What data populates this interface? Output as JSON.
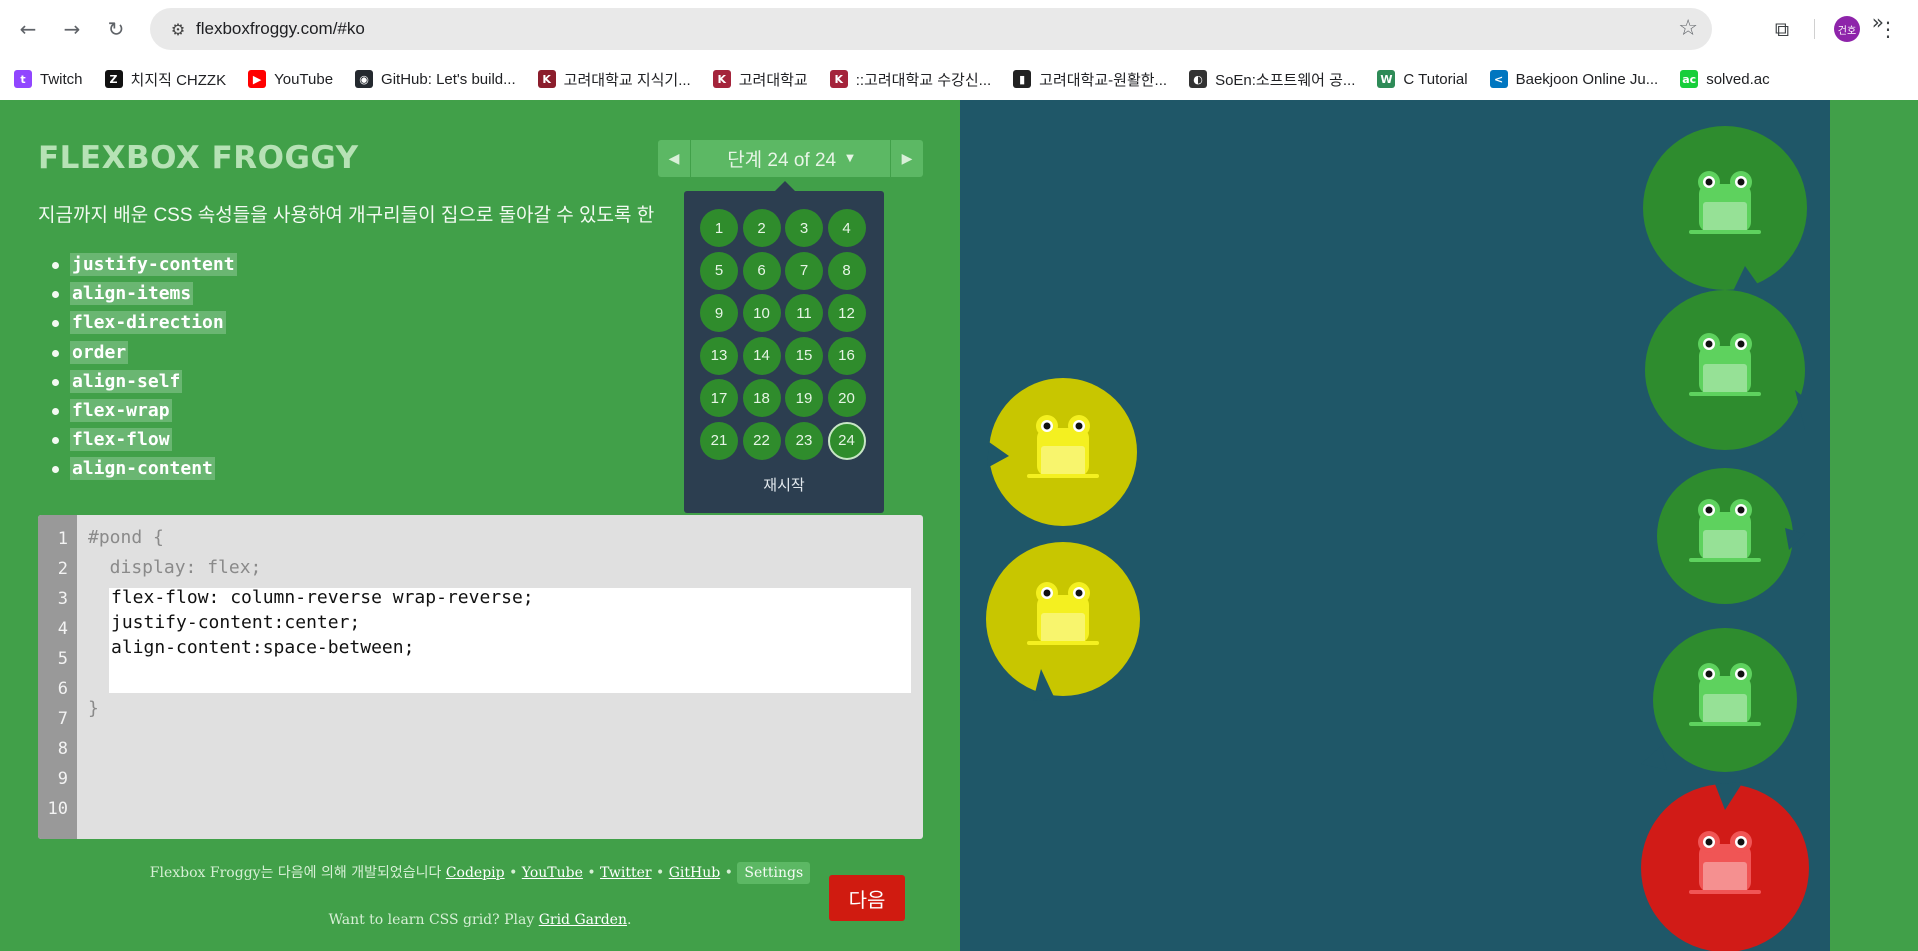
{
  "browser": {
    "url": "flexboxfroggy.com/#ko",
    "back_icon": "arrow-left-icon",
    "avatar_label": "건호",
    "bookmarks": [
      {
        "label": "Twitch",
        "color": "#9146ff",
        "glyph": "t"
      },
      {
        "label": "치지직 CHZZK",
        "color": "#111111",
        "glyph": "Z"
      },
      {
        "label": "YouTube",
        "color": "#ff0000",
        "glyph": "▶"
      },
      {
        "label": "GitHub: Let's build...",
        "color": "#24292f",
        "glyph": "◉"
      },
      {
        "label": "고려대학교 지식기...",
        "color": "#8b1d2c",
        "glyph": "K"
      },
      {
        "label": "고려대학교",
        "color": "#a4243b",
        "glyph": "K"
      },
      {
        "label": "::고려대학교 수강신...",
        "color": "#a4243b",
        "glyph": "K"
      },
      {
        "label": "고려대학교-원활한...",
        "color": "#222222",
        "glyph": "▮"
      },
      {
        "label": "SoEn:소프트웨어 공...",
        "color": "#333333",
        "glyph": "◐"
      },
      {
        "label": "C Tutorial",
        "color": "#2e8b57",
        "glyph": "W"
      },
      {
        "label": "Baekjoon Online Ju...",
        "color": "#0076c0",
        "glyph": "<"
      },
      {
        "label": "solved.ac",
        "color": "#17ce3a",
        "glyph": "ac"
      }
    ],
    "more_label": "»"
  },
  "game": {
    "title": "FLEXBOX FROGGY",
    "level_indicator": "단계 24 of 24",
    "prev_arrow": "◀",
    "next_arrow": "▶",
    "instructions": "지금까지 배운 CSS 속성들을 사용하여 개구리들이 집으로 돌아갈 수 있도록 한",
    "properties": [
      "justify-content",
      "align-items",
      "flex-direction",
      "order",
      "align-self",
      "flex-wrap",
      "flex-flow",
      "align-content"
    ],
    "levels": [
      "1",
      "2",
      "3",
      "4",
      "5",
      "6",
      "7",
      "8",
      "9",
      "10",
      "11",
      "12",
      "13",
      "14",
      "15",
      "16",
      "17",
      "18",
      "19",
      "20",
      "21",
      "22",
      "23",
      "24"
    ],
    "current_level": "24",
    "reset_label": "재시작",
    "line_numbers": [
      "1",
      "2",
      "3",
      "4",
      "5",
      "6",
      "7",
      "8",
      "9",
      "10"
    ],
    "code_before": [
      "#pond {",
      "  display: flex;"
    ],
    "code_input": [
      "flex-flow: column-reverse wrap-reverse;",
      "justify-content:center;",
      "align-content:space-between;"
    ],
    "code_after": [
      "}"
    ],
    "next_button": "다음",
    "credits_prefix": "Flexbox Froggy는 다음에 의해 개발되었습니다",
    "credits_links": [
      "Codepip",
      "YouTube",
      "Twitter",
      "GitHub"
    ],
    "settings_label": "Settings",
    "learn_prefix": "Want to learn CSS grid? Play",
    "learn_link": "Grid Garden",
    "learn_suffix": "."
  },
  "pond": {
    "colors": {
      "green": "#2e8c2e",
      "yellow": "#c8c600",
      "red": "#d11b17",
      "water": "#1f5768"
    }
  }
}
